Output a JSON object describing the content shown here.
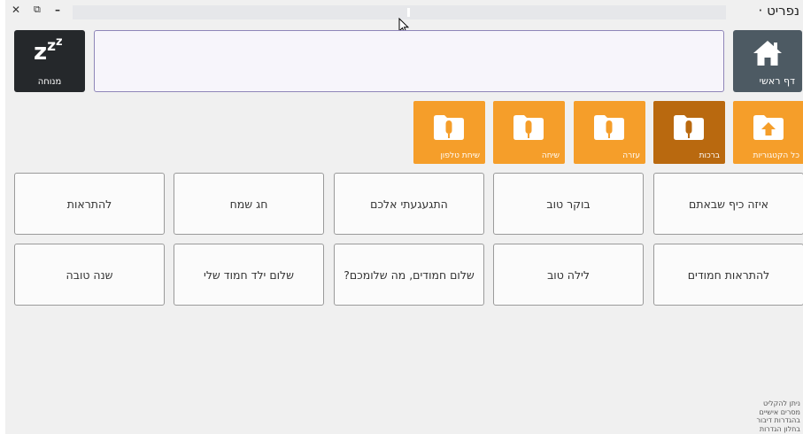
{
  "window": {
    "title": "נפריט ·",
    "close_glyph": "✕",
    "restore_glyph": "⧉",
    "minimize_glyph": "–"
  },
  "header": {
    "home_label": "דף ראשי",
    "rest_label": "מנוחה",
    "rest_zzz": [
      "z",
      "z",
      "z"
    ],
    "text_bar_value": ""
  },
  "categories": [
    {
      "label": "כל הקטגוריות",
      "icon": "folder-up-icon",
      "selected": false
    },
    {
      "label": "ברכות",
      "icon": "folder-mic-icon",
      "selected": true
    },
    {
      "label": "עזרה",
      "icon": "folder-mic-icon",
      "selected": false
    },
    {
      "label": "שיחה",
      "icon": "folder-mic-icon",
      "selected": false
    },
    {
      "label": "שיחת טלפון",
      "icon": "folder-mic-icon",
      "selected": false
    }
  ],
  "phrases": [
    "איזה כיף שבאתם",
    "בוקר טוב",
    "התגעגעתי אלכם",
    "חג שמח",
    "להתראות",
    "להתראות חמודים",
    "לילה טוב",
    "שלום חמודים, מה שלומכם?",
    "שלום ילד חמוד שלי",
    "שנה טובה"
  ],
  "hint_lines": [
    "ניתן להקליט",
    "מסרים אישיים",
    "בהגדרות דיבור",
    "בחלון הגדרות"
  ],
  "colors": {
    "home_bg": "#4d5a63",
    "rest_bg": "#25282b",
    "category_bg": "#f59e2a",
    "category_selected_bg": "#b9690f",
    "text_bar_border": "#8f86b8"
  }
}
